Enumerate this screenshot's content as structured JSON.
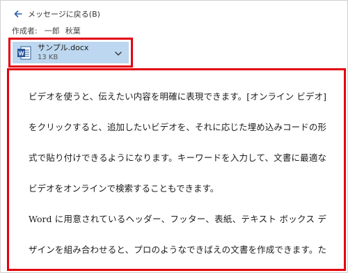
{
  "back": {
    "label": "メッセージに戻る(B)"
  },
  "meta": {
    "label": "作成者:",
    "author_family": "一郎",
    "author_given": "秋葉"
  },
  "attachment": {
    "name": "サンプル.docx",
    "size": "13 KB",
    "icon": "word-doc-icon"
  },
  "preview": {
    "lines": [
      "ビデオを使うと、伝えたい内容を明確に表現できます。[オンライン ビデオ]",
      "をクリックすると、追加したいビデオを、それに応じた埋め込みコードの形",
      "式で貼り付けできるようになります。キーワードを入力して、文書に最適な",
      "ビデオをオンラインで検索することもできます。",
      "Word に用意されているヘッダー、フッター、表紙、テキスト ボックス デ",
      "ザインを組み合わせると、プロのようなできばえの文書を作成できます。た"
    ]
  },
  "colors": {
    "highlight": "#e3000f",
    "attachment_bg": "#bcd7ef",
    "word_blue": "#2b5797",
    "back_arrow": "#2b5fa8"
  }
}
